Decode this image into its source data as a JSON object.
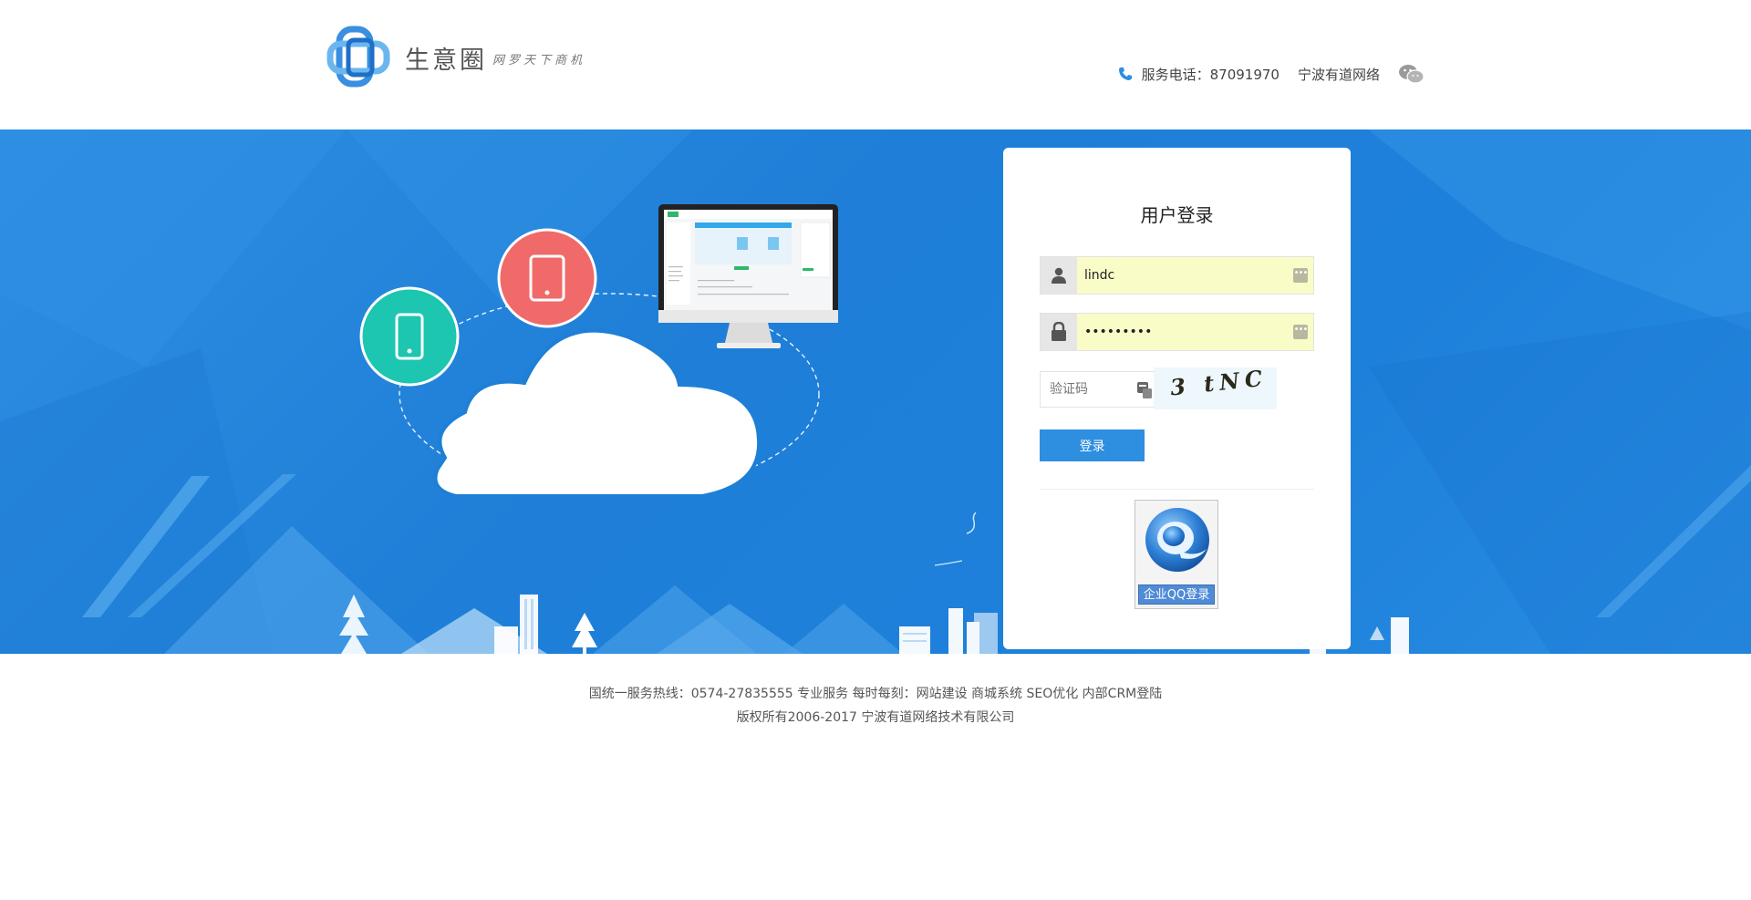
{
  "header": {
    "logo_name": "生意圈",
    "logo_slogan": "网罗天下商机",
    "phone_label": "服务电话：87091970",
    "company": "宁波有道网络"
  },
  "login": {
    "title": "用户登录",
    "username_value": "lindc",
    "password_value": "•••••••••",
    "captcha_placeholder": "验证码",
    "captcha_text": "3 tNC",
    "submit_label": "登录",
    "qq_login_label": "企业QQ登录"
  },
  "footer": {
    "line1": "国统一服务热线：0574-27835555 专业服务 每时每刻：网站建设 商城系统 SEO优化 内部CRM登陆",
    "line2": "版权所有2006-2017 宁波有道网络技术有限公司"
  },
  "colors": {
    "banner_blue": "#1f7fd8",
    "button_blue": "#2e8ee0",
    "tablet_red": "#f06a6a",
    "phone_teal": "#1cc6b0"
  },
  "icons": [
    "logo-mark-icon",
    "phone-icon",
    "wechat-icon",
    "user-icon",
    "lock-icon",
    "key-icon",
    "captcha-icon",
    "qq-enterprise-icon",
    "cloud-icon",
    "tablet-icon",
    "mobile-icon",
    "monitor-icon"
  ]
}
